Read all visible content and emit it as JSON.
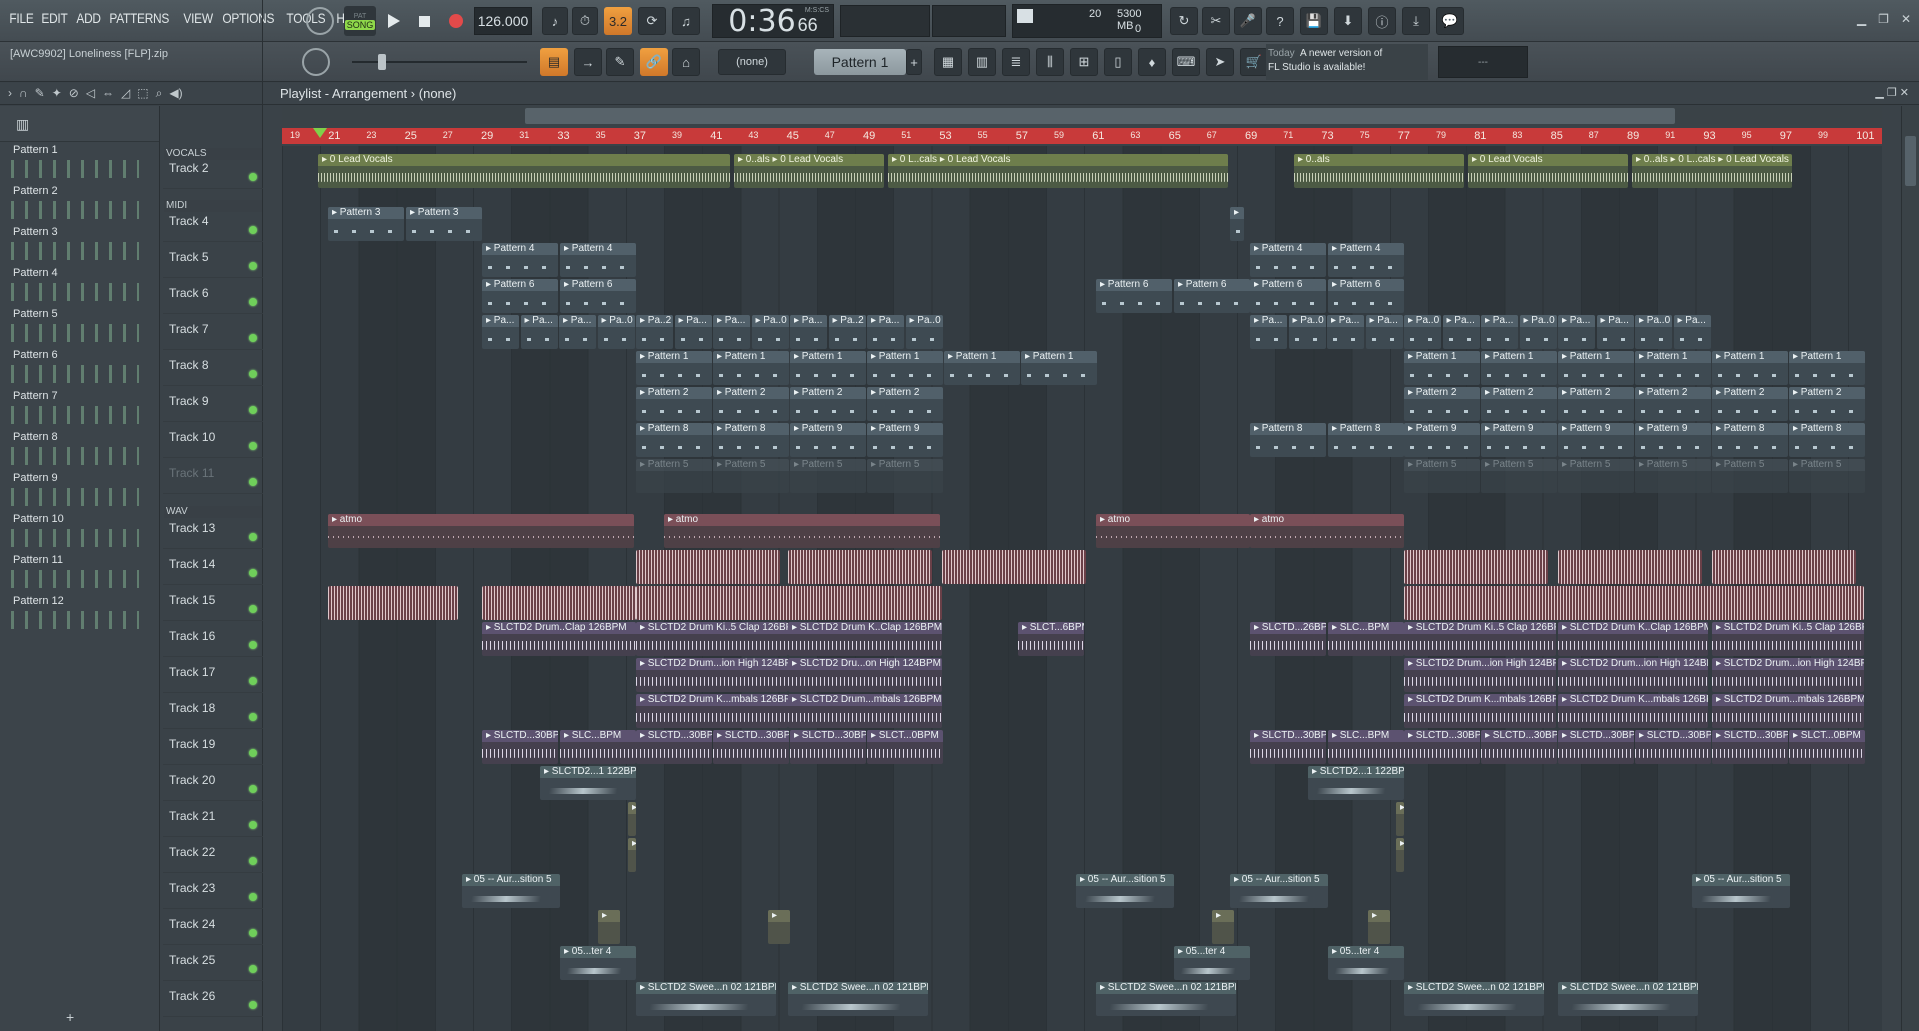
{
  "menu": [
    "FILE",
    "EDIT",
    "ADD",
    "PATTERNS",
    "VIEW",
    "OPTIONS",
    "TOOLS",
    "HELP"
  ],
  "transport": {
    "mode": "SONG",
    "tempo": "126.000",
    "time": "0:36",
    "time_sub": "66",
    "time_unit": "M:S:CS",
    "snap": "3.2"
  },
  "monitor": {
    "cpu": "20",
    "mem": "5300 MB",
    "poly": "0"
  },
  "project": {
    "file": "[AWC9902] Loneliness [FLP].zip"
  },
  "pattern_selector": {
    "channel": "(none)",
    "pattern": "Pattern 1"
  },
  "hint": {
    "day": "Today",
    "text1": "A newer version of",
    "text2": "FL Studio is available!"
  },
  "hint_extra": "---",
  "playlist": {
    "title": "Playlist - Arrangement",
    "sep": "›",
    "sub": "(none)"
  },
  "picker_patterns": [
    "Pattern 1",
    "Pattern 2",
    "Pattern 3",
    "Pattern 4",
    "Pattern 5",
    "Pattern 6",
    "Pattern 7",
    "Pattern 8",
    "Pattern 9",
    "Pattern 10",
    "Pattern 11",
    "Pattern 12"
  ],
  "picker_add": "+",
  "groups": [
    "VOCALS",
    "MIDI",
    "WAV"
  ],
  "tracks": [
    "Track 2",
    "Track 4",
    "Track 5",
    "Track 6",
    "Track 7",
    "Track 8",
    "Track 9",
    "Track 10",
    "Track 11",
    "Track 13",
    "Track 14",
    "Track 15",
    "Track 16",
    "Track 17",
    "Track 18",
    "Track 19",
    "Track 20",
    "Track 21",
    "Track 22",
    "Track 23",
    "Track 24",
    "Track 25",
    "Track 26"
  ],
  "ruler_bars": [
    "19",
    "21",
    "23",
    "25",
    "27",
    "29",
    "31",
    "33",
    "35",
    "37",
    "39",
    "41",
    "43",
    "45",
    "47",
    "49",
    "51",
    "53",
    "55",
    "57",
    "59",
    "61",
    "63",
    "65",
    "67",
    "69",
    "71",
    "73",
    "75",
    "77",
    "79",
    "81",
    "83",
    "85",
    "87",
    "89",
    "91",
    "93",
    "95",
    "97",
    "99",
    "101"
  ],
  "clip_labels": {
    "vocal": "0 Lead Vocals",
    "vocal_s1": "0..als",
    "vocal_s2": "0 L..cals",
    "p1": "Pattern 1",
    "p2": "Pattern 2",
    "p3": "Pattern 3",
    "p4": "Pattern 4",
    "p5": "Pattern 5",
    "p6": "Pattern 6",
    "p8": "Pattern 8",
    "p9": "Pattern 9",
    "p_short": "Pa...",
    "p_short0": "Pa..0",
    "p_short2": "Pa..2",
    "atmo": "atmo",
    "clap": "SLCTD2 Drum Ki..5 Clap 126BPM",
    "clap_s": "SLCTD2 Drum K..Clap 126BPM",
    "clap_xs": "SLCTD2 Drum..Clap 126BPM",
    "slct_68": "SLCT...6BPM",
    "slct_26": "SLCTD...26BPM",
    "slc_bpm": "SLC...BPM",
    "high": "SLCTD2 Drum...ion High 124BPM",
    "high_s": "SLCTD2 Dru...on High 124BPM",
    "cym": "SLCTD2 Drum K...mbals 126BPM",
    "cym_s": "SLCTD2 Drum...mbals 126BPM",
    "s30": "SLCTD...30BPM",
    "slct0": "SLCT...0BPM",
    "s122": "SLCTD2...1 122BPM",
    "aur": "05 -- Aur...sition 5",
    "ter": "05...ter 4",
    "sweep": "SLCTD2 Swee...n 02 121BPM"
  }
}
